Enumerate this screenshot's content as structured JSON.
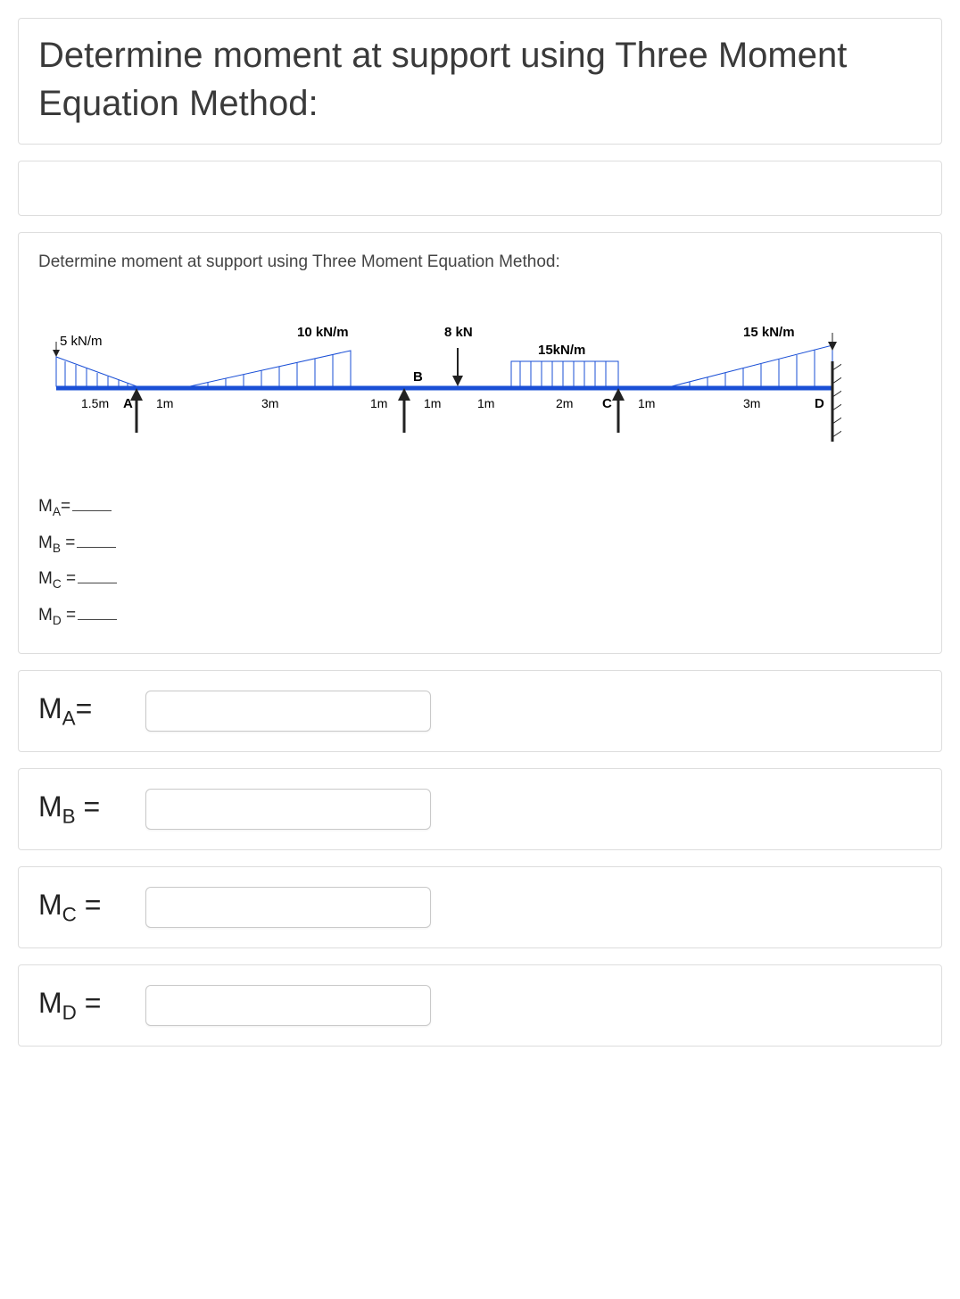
{
  "title": "Determine  moment at support using Three Moment Equation Method:",
  "prompt": "Determine  moment at support using Three Moment Equation Method:",
  "diagram": {
    "loads": {
      "tri_left": "5 kN/m",
      "tri_mid": "10 kN/m",
      "point": "8 kN",
      "udl": "15kN/m",
      "tri_right": "15 kN/m"
    },
    "supports": {
      "A": "A",
      "B": "B",
      "C": "C",
      "D": "D"
    },
    "dims": {
      "d0": "1.5m",
      "d1": "1m",
      "d2": "3m",
      "d3": "1m",
      "d4": "1m",
      "d5": "1m",
      "d6": "2m",
      "d7": "1m",
      "d8": "3m"
    }
  },
  "blanks": [
    {
      "symbol": "M",
      "sub": "A",
      "suffix": "="
    },
    {
      "symbol": "M",
      "sub": "B",
      "suffix": " ="
    },
    {
      "symbol": "M",
      "sub": "C",
      "suffix": " ="
    },
    {
      "symbol": "M",
      "sub": "D",
      "suffix": " ="
    }
  ],
  "answers": [
    {
      "symbol": "M",
      "sub": "A",
      "suffix": "="
    },
    {
      "symbol": "M",
      "sub": "B",
      "suffix": " ="
    },
    {
      "symbol": "M",
      "sub": "C",
      "suffix": " ="
    },
    {
      "symbol": "M",
      "sub": "D",
      "suffix": " ="
    }
  ]
}
